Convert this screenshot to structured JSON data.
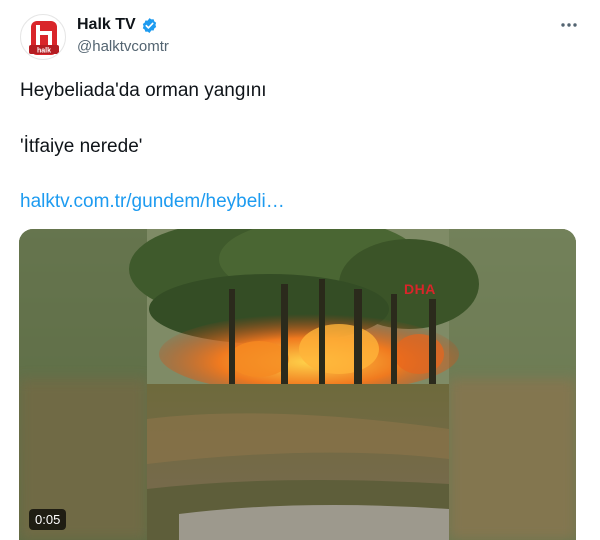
{
  "account": {
    "display_name": "Halk TV",
    "handle": "@halktvcomtr",
    "avatar_logo_text": "halk",
    "verified": true
  },
  "tweet": {
    "line1": "Heybeliada'da orman yangını",
    "line2": "'İtfaiye nerede'",
    "link": "halktv.com.tr/gundem/heybeli…"
  },
  "media": {
    "type": "video",
    "duration": "0:05",
    "watermark": "DHA"
  },
  "icons": {
    "more": "more-horizontal-icon",
    "verified": "verified-badge-icon"
  },
  "colors": {
    "link": "#1d9bf0",
    "verified": "#1d9bf0",
    "brand_red": "#d9252a"
  }
}
